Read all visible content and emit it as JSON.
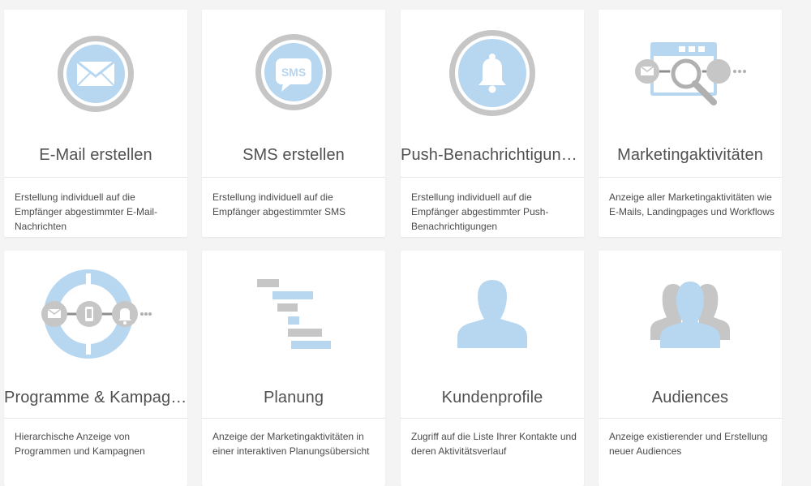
{
  "cards": [
    {
      "title": "E-Mail erstellen",
      "description": "Erstellung individuell auf die Empfänger abgestimmter E-Mail-Nachrichten",
      "icon": "envelope-icon"
    },
    {
      "title": "SMS erstellen",
      "description": "Erstellung individuell auf die Empfänger abgestimmter SMS",
      "icon": "sms-icon",
      "icon_text": "SMS"
    },
    {
      "title": "Push-Benachrichtigung e...",
      "description": "Erstellung individuell auf die Empfänger abgestimmter Push-Benachrichtigungen",
      "icon": "bell-icon"
    },
    {
      "title": "Marketingaktivitäten",
      "description": "Anzeige aller Marketingaktivitäten wie E-Mails, Landingpages und Workflows",
      "icon": "marketing-activities-icon"
    },
    {
      "title": "Programme & Kampagn...",
      "description": "Hierarchische Anzeige von Programmen und Kampagnen",
      "icon": "programs-campaigns-icon"
    },
    {
      "title": "Planung",
      "description": "Anzeige der Marketingaktivitäten in einer interaktiven Planungsübersicht",
      "icon": "gantt-planning-icon"
    },
    {
      "title": "Kundenprofile",
      "description": "Zugriff auf die Liste Ihrer Kontakte und deren Aktivitätsverlauf",
      "icon": "person-silhouette-icon"
    },
    {
      "title": "Audiences",
      "description": "Anzeige existierender und Erstellung neuer Audiences",
      "icon": "audience-group-icon"
    }
  ],
  "colors": {
    "accent_blue": "#b7d6f0",
    "icon_gray": "#c6c6c6",
    "text": "#505050",
    "background": "#f4f4f4"
  }
}
